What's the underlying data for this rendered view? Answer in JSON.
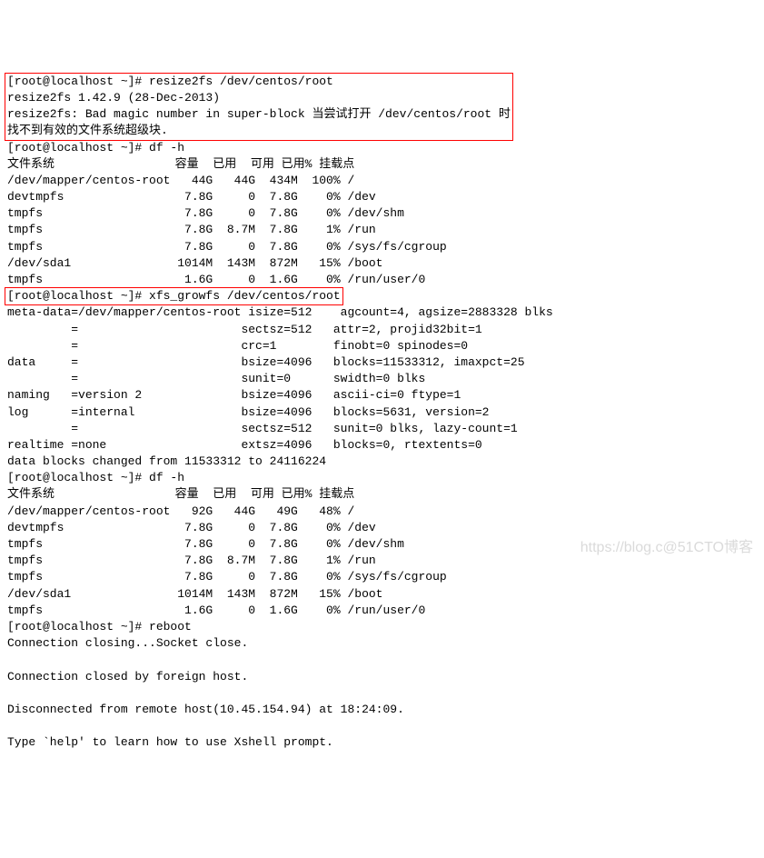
{
  "block1": {
    "l1": "[root@localhost ~]# resize2fs /dev/centos/root",
    "l2": "resize2fs 1.42.9 (28-Dec-2013)",
    "l3": "resize2fs: Bad magic number in super-block 当尝试打开 /dev/centos/root 时",
    "l4": "找不到有效的文件系统超级块."
  },
  "df1": {
    "prompt": "[root@localhost ~]# df -h",
    "header": "文件系统                 容量  已用  可用 已用% 挂载点",
    "rows": [
      "/dev/mapper/centos-root   44G   44G  434M  100% /",
      "devtmpfs                 7.8G     0  7.8G    0% /dev",
      "tmpfs                    7.8G     0  7.8G    0% /dev/shm",
      "tmpfs                    7.8G  8.7M  7.8G    1% /run",
      "tmpfs                    7.8G     0  7.8G    0% /sys/fs/cgroup",
      "/dev/sda1               1014M  143M  872M   15% /boot",
      "tmpfs                    1.6G     0  1.6G    0% /run/user/0"
    ]
  },
  "xfscmd": "[root@localhost ~]# xfs_growfs /dev/centos/root",
  "xfs": [
    "meta-data=/dev/mapper/centos-root isize=512    agcount=4, agsize=2883328 blks",
    "         =                       sectsz=512   attr=2, projid32bit=1",
    "         =                       crc=1        finobt=0 spinodes=0",
    "data     =                       bsize=4096   blocks=11533312, imaxpct=25",
    "         =                       sunit=0      swidth=0 blks",
    "naming   =version 2              bsize=4096   ascii-ci=0 ftype=1",
    "log      =internal               bsize=4096   blocks=5631, version=2",
    "         =                       sectsz=512   sunit=0 blks, lazy-count=1",
    "realtime =none                   extsz=4096   blocks=0, rtextents=0",
    "data blocks changed from 11533312 to 24116224"
  ],
  "df2": {
    "prompt": "[root@localhost ~]# df -h",
    "header": "文件系统                 容量  已用  可用 已用% 挂载点",
    "rows": [
      "/dev/mapper/centos-root   92G   44G   49G   48% /",
      "devtmpfs                 7.8G     0  7.8G    0% /dev",
      "tmpfs                    7.8G     0  7.8G    0% /dev/shm",
      "tmpfs                    7.8G  8.7M  7.8G    1% /run",
      "tmpfs                    7.8G     0  7.8G    0% /sys/fs/cgroup",
      "/dev/sda1               1014M  143M  872M   15% /boot",
      "tmpfs                    1.6G     0  1.6G    0% /run/user/0"
    ]
  },
  "tail": {
    "reboot": "[root@localhost ~]# reboot",
    "closing": "Connection closing...Socket close.",
    "closed": "Connection closed by foreign host.",
    "disc": "Disconnected from remote host(10.45.154.94) at 18:24:09.",
    "help": "Type `help' to learn how to use Xshell prompt."
  },
  "watermark": "https://blog.c@51CTO博客"
}
